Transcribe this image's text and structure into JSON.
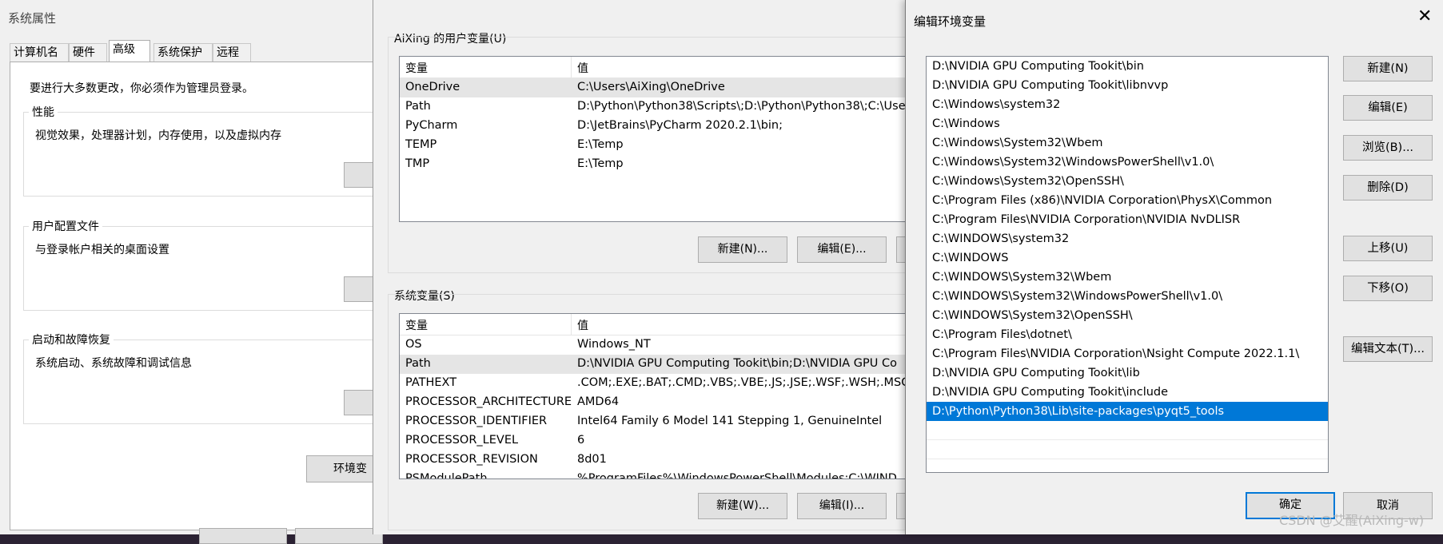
{
  "system_properties": {
    "title": "系统属性",
    "tabs": [
      "计算机名",
      "硬件",
      "高级",
      "系统保护",
      "远程"
    ],
    "active_tab": "高级",
    "admin_note": "要进行大多数更改，你必须作为管理员登录。",
    "performance": {
      "title": "性能",
      "desc": "视觉效果，处理器计划，内存使用，以及虚拟内存"
    },
    "user_profiles": {
      "title": "用户配置文件",
      "desc": "与登录帐户相关的桌面设置"
    },
    "startup_recovery": {
      "title": "启动和故障恢复",
      "desc": "系统启动、系统故障和调试信息"
    },
    "env_button_label": "环境变"
  },
  "env_vars": {
    "user_section_label": "AiXing 的用户变量(U)",
    "system_section_label": "系统变量(S)",
    "col_variable": "变量",
    "col_value": "值",
    "user_vars": [
      {
        "name": "OneDrive",
        "value": "C:\\Users\\AiXing\\OneDrive"
      },
      {
        "name": "Path",
        "value": "D:\\Python\\Python38\\Scripts\\;D:\\Python\\Python38\\;C:\\Use"
      },
      {
        "name": "PyCharm",
        "value": "D:\\JetBrains\\PyCharm 2020.2.1\\bin;"
      },
      {
        "name": "TEMP",
        "value": "E:\\Temp"
      },
      {
        "name": "TMP",
        "value": "E:\\Temp"
      }
    ],
    "system_vars": [
      {
        "name": "OS",
        "value": "Windows_NT"
      },
      {
        "name": "Path",
        "value": "D:\\NVIDIA GPU Computing Tookit\\bin;D:\\NVIDIA GPU Co"
      },
      {
        "name": "PATHEXT",
        "value": ".COM;.EXE;.BAT;.CMD;.VBS;.VBE;.JS;.JSE;.WSF;.WSH;.MSC"
      },
      {
        "name": "PROCESSOR_ARCHITECTURE",
        "value": "AMD64"
      },
      {
        "name": "PROCESSOR_IDENTIFIER",
        "value": "Intel64 Family 6 Model 141 Stepping 1, GenuineIntel"
      },
      {
        "name": "PROCESSOR_LEVEL",
        "value": "6"
      },
      {
        "name": "PROCESSOR_REVISION",
        "value": "8d01"
      },
      {
        "name": "PSModulePath",
        "value": "%ProgramFiles%\\WindowsPowerShell\\Modules;C:\\WIND"
      }
    ],
    "user_buttons": {
      "new": "新建(N)...",
      "edit": "编辑(E)..."
    },
    "system_buttons": {
      "new": "新建(W)...",
      "edit": "编辑(I)..."
    }
  },
  "edit_env": {
    "title": "编辑环境变量",
    "close_glyph": "✕",
    "paths": [
      "D:\\NVIDIA GPU Computing Tookit\\bin",
      "D:\\NVIDIA GPU Computing Tookit\\libnvvp",
      "C:\\Windows\\system32",
      "C:\\Windows",
      "C:\\Windows\\System32\\Wbem",
      "C:\\Windows\\System32\\WindowsPowerShell\\v1.0\\",
      "C:\\Windows\\System32\\OpenSSH\\",
      "C:\\Program Files (x86)\\NVIDIA Corporation\\PhysX\\Common",
      "C:\\Program Files\\NVIDIA Corporation\\NVIDIA NvDLISR",
      "C:\\WINDOWS\\system32",
      "C:\\WINDOWS",
      "C:\\WINDOWS\\System32\\Wbem",
      "C:\\WINDOWS\\System32\\WindowsPowerShell\\v1.0\\",
      "C:\\WINDOWS\\System32\\OpenSSH\\",
      "C:\\Program Files\\dotnet\\",
      "C:\\Program Files\\NVIDIA Corporation\\Nsight Compute 2022.1.1\\",
      "D:\\NVIDIA GPU Computing Tookit\\lib",
      "D:\\NVIDIA GPU Computing Tookit\\include",
      "D:\\Python\\Python38\\Lib\\site-packages\\pyqt5_tools"
    ],
    "selected_path": "D:\\Python\\Python38\\Lib\\site-packages\\pyqt5_tools",
    "buttons": {
      "new": "新建(N)",
      "edit": "编辑(E)",
      "browse": "浏览(B)...",
      "delete": "删除(D)",
      "move_up": "上移(U)",
      "move_down": "下移(O)",
      "edit_text": "编辑文本(T)...",
      "ok": "确定",
      "cancel": "取消"
    }
  },
  "watermark": "CSDN @艾醒(AiXing-w)"
}
